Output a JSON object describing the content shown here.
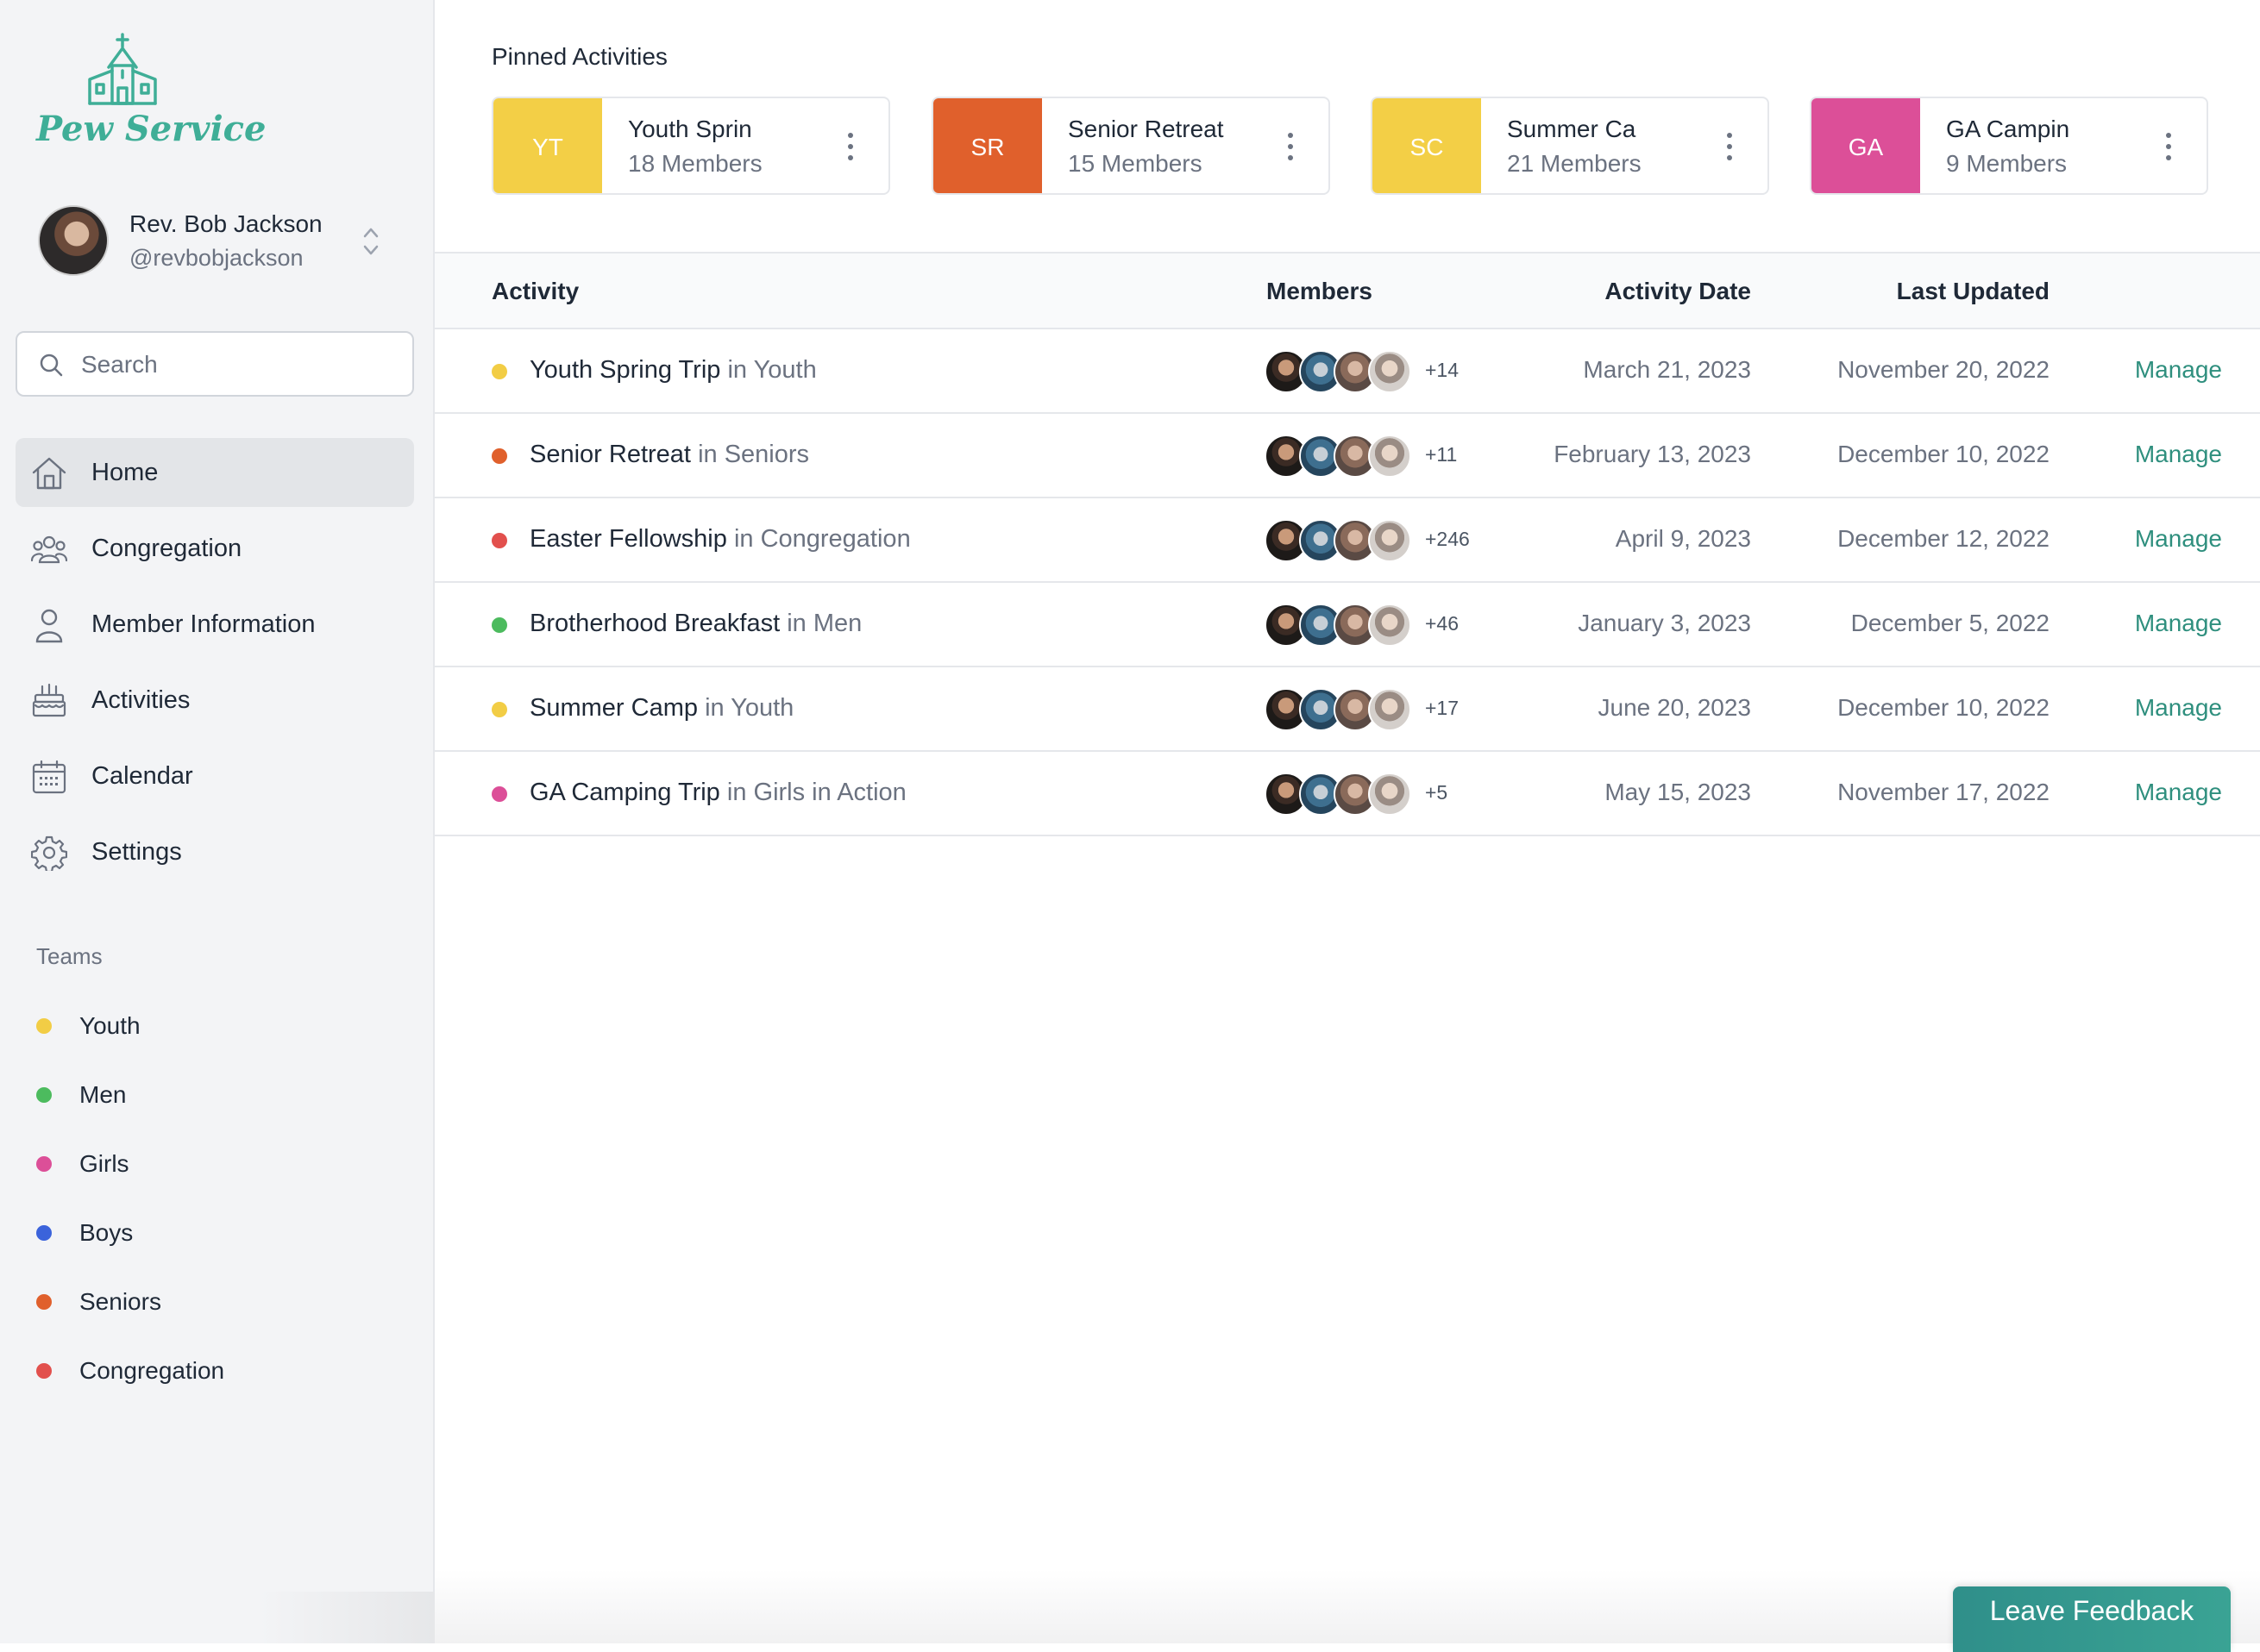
{
  "app": {
    "name": "Pew Service",
    "brand_color": "#3fae97"
  },
  "user": {
    "name": "Rev. Bob Jackson",
    "handle": "@revbobjackson"
  },
  "search": {
    "placeholder": "Search"
  },
  "nav": [
    {
      "label": "Home",
      "icon": "home-icon",
      "active": true
    },
    {
      "label": "Congregation",
      "icon": "users-icon",
      "active": false
    },
    {
      "label": "Member Information",
      "icon": "user-icon",
      "active": false
    },
    {
      "label": "Activities",
      "icon": "cake-icon",
      "active": false
    },
    {
      "label": "Calendar",
      "icon": "calendar-icon",
      "active": false
    },
    {
      "label": "Settings",
      "icon": "gear-icon",
      "active": false
    }
  ],
  "teams": {
    "title": "Teams",
    "items": [
      {
        "label": "Youth",
        "color": "#f2cd45"
      },
      {
        "label": "Men",
        "color": "#4cbb5e"
      },
      {
        "label": "Girls",
        "color": "#dc4f98"
      },
      {
        "label": "Boys",
        "color": "#3b63db"
      },
      {
        "label": "Seniors",
        "color": "#e0602c"
      },
      {
        "label": "Congregation",
        "color": "#e2504d"
      }
    ]
  },
  "pinned": {
    "title": "Pinned Activities",
    "items": [
      {
        "initials": "YT",
        "name": "Youth Sprin",
        "members": "18 Members",
        "color": "#f3cf46"
      },
      {
        "initials": "SR",
        "name": "Senior Retreat",
        "members": "15 Members",
        "color": "#e0602c"
      },
      {
        "initials": "SC",
        "name": "Summer Ca",
        "members": "21 Members",
        "color": "#f3cf46"
      },
      {
        "initials": "GA",
        "name": "GA Campin",
        "members": "9 Members",
        "color": "#dc4f98"
      }
    ]
  },
  "table": {
    "headers": {
      "activity": "Activity",
      "members": "Members",
      "activity_date": "Activity Date",
      "last_updated": "Last Updated"
    },
    "rows": [
      {
        "title": "Youth Spring Trip",
        "team": "in Youth",
        "color": "#f2cd45",
        "extra": "+14",
        "date": "March 21, 2023",
        "updated": "November 20, 2022",
        "action": "Manage"
      },
      {
        "title": "Senior Retreat",
        "team": "in Seniors",
        "color": "#e0602c",
        "extra": "+11",
        "date": "February 13, 2023",
        "updated": "December 10, 2022",
        "action": "Manage"
      },
      {
        "title": "Easter Fellowship",
        "team": "in Congregation",
        "color": "#e2504d",
        "extra": "+246",
        "date": "April 9, 2023",
        "updated": "December 12, 2022",
        "action": "Manage"
      },
      {
        "title": "Brotherhood Breakfast",
        "team": "in Men",
        "color": "#4cbb5e",
        "extra": "+46",
        "date": "January 3, 2023",
        "updated": "December 5, 2022",
        "action": "Manage"
      },
      {
        "title": "Summer Camp",
        "team": "in Youth",
        "color": "#f2cd45",
        "extra": "+17",
        "date": "June 20, 2023",
        "updated": "December 10, 2022",
        "action": "Manage"
      },
      {
        "title": "GA Camping Trip",
        "team": "in Girls in Action",
        "color": "#dc4f98",
        "extra": "+5",
        "date": "May 15, 2023",
        "updated": "November 17, 2022",
        "action": "Manage"
      }
    ]
  },
  "feedback": {
    "label": "Leave Feedback"
  }
}
